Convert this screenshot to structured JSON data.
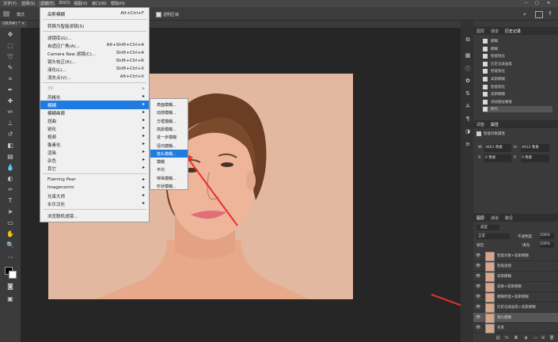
{
  "menubar": {
    "items": [
      "文字(Y)",
      "选择(S)",
      "滤镜(T)",
      "3D(D)",
      "视图(V)",
      "窗口(W)",
      "帮助(H)"
    ],
    "active_index": 2
  },
  "options_bar": {
    "label_left": "模式",
    "label_right": "透明区域"
  },
  "document_tab": {
    "label": "GB/8#) * ×"
  },
  "filter_menu": {
    "items": [
      {
        "label": "高斯模糊",
        "shortcut": "Alt+Ctrl+F"
      },
      {
        "sep": true
      },
      {
        "label": "转换为智能滤镜(S)"
      },
      {
        "sep": true
      },
      {
        "label": "滤镜库(G)..."
      },
      {
        "label": "自适应广角(A)...",
        "shortcut": "Alt+Shift+Ctrl+A"
      },
      {
        "label": "Camera Raw 滤镜(C)...",
        "shortcut": "Shift+Ctrl+A"
      },
      {
        "label": "镜头校正(R)...",
        "shortcut": "Shift+Ctrl+R"
      },
      {
        "label": "液化(L)...",
        "shortcut": "Shift+Ctrl+X"
      },
      {
        "label": "消失点(V)...",
        "shortcut": "Alt+Ctrl+V"
      },
      {
        "sep": true
      },
      {
        "label": "3D",
        "submenu": true,
        "disabled": true
      },
      {
        "label": "风格化",
        "submenu": true
      },
      {
        "label": "模糊",
        "submenu": true,
        "highlight": true
      },
      {
        "label": "模糊画廊",
        "submenu": true
      },
      {
        "label": "扭曲",
        "submenu": true
      },
      {
        "label": "锐化",
        "submenu": true
      },
      {
        "label": "视频",
        "submenu": true
      },
      {
        "label": "像素化",
        "submenu": true
      },
      {
        "label": "渲染",
        "submenu": true
      },
      {
        "label": "杂色",
        "submenu": true
      },
      {
        "label": "其它",
        "submenu": true
      },
      {
        "sep": true
      },
      {
        "label": "Flaming Pear",
        "submenu": true
      },
      {
        "label": "Imagenomic",
        "submenu": true
      },
      {
        "label": "光束大师",
        "submenu": true
      },
      {
        "label": "永乐汉化",
        "submenu": true
      },
      {
        "sep": true
      },
      {
        "label": "浏览联机滤镜..."
      }
    ]
  },
  "blur_menu": {
    "items": [
      {
        "label": "表面模糊..."
      },
      {
        "label": "动感模糊..."
      },
      {
        "label": "方框模糊..."
      },
      {
        "label": "高斯模糊..."
      },
      {
        "label": "进一步模糊"
      },
      {
        "label": "径向模糊..."
      },
      {
        "label": "镜头模糊...",
        "highlight": true
      },
      {
        "label": "模糊"
      },
      {
        "label": "平均"
      },
      {
        "label": "特殊模糊..."
      },
      {
        "label": "形状模糊..."
      }
    ]
  },
  "history_panel": {
    "tabs": [
      "图层",
      "通道",
      "历史记录"
    ],
    "items": [
      "模糊",
      "模糊",
      "智能锐化",
      "历史记录画笔",
      "智能锐化",
      "高斯模糊",
      "智能锐化",
      "高斯模糊",
      "添加图层蒙版",
      "拷贝"
    ]
  },
  "properties_panel": {
    "tabs": [
      "调整",
      "属性"
    ],
    "title": "智能对象属性",
    "w_label": "W:",
    "w_value": "3661 像素",
    "h_label": "H:",
    "h_value": "4912 像素",
    "x_label": "X:",
    "x_value": "0 像素",
    "y_label": "Y:",
    "y_value": "0 像素"
  },
  "layers_panel": {
    "tabs": [
      "图层",
      "通道",
      "路径"
    ],
    "kind_label": "类型",
    "blend_mode": "正常",
    "opacity_label": "不透明度:",
    "opacity_value": "100%",
    "lock_label": "锁定:",
    "fill_label": "填充:",
    "fill_value": "100%",
    "layers": [
      {
        "name": "智能对象+高斯模糊"
      },
      {
        "name": "智能滤镜"
      },
      {
        "name": "高斯模糊"
      },
      {
        "name": "皮肤+高斯模糊"
      },
      {
        "name": "模糊修复+高斯模糊"
      },
      {
        "name": "历史记录画笔+高斯模糊"
      },
      {
        "name": "镜头模糊"
      },
      {
        "name": "背景"
      }
    ]
  },
  "colors": {
    "highlight": "#1f7be0",
    "photo_bg": "#e2b9a0",
    "arrow": "#e8302a"
  }
}
